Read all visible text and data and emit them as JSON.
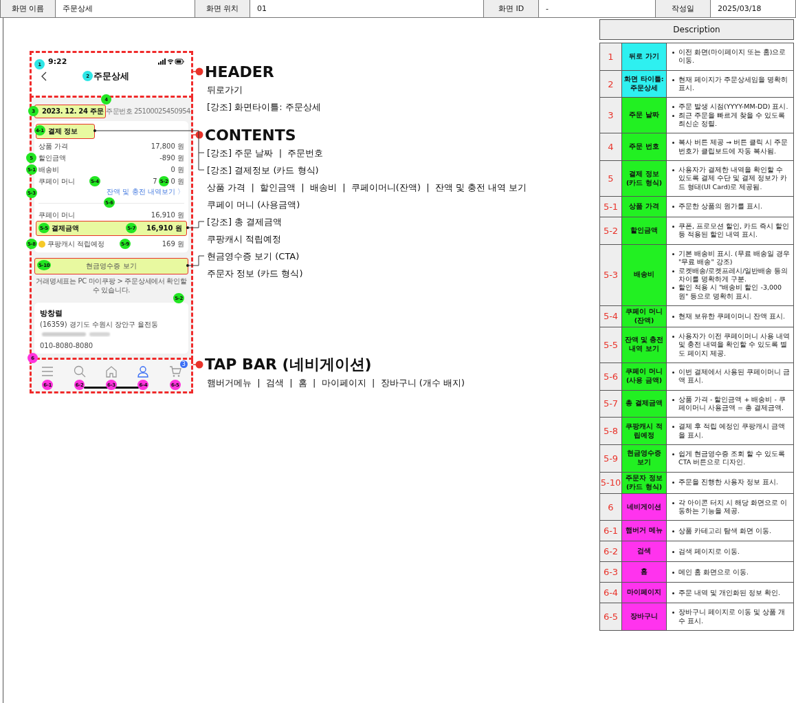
{
  "header_table": [
    {
      "label": "화면 이름",
      "value": "주문상세"
    },
    {
      "label": "화면 위치",
      "value": "01"
    },
    {
      "label": "화면 ID",
      "value": "-"
    },
    {
      "label": "작성일",
      "value": "2025/03/18"
    }
  ],
  "phone": {
    "time": "9:22",
    "title": "주문상세",
    "order_date": "2023. 12. 24 주문",
    "order_number": "주문번호 25100025450954",
    "payment_title": "결제 정보",
    "rows": [
      {
        "label": "상품 가격",
        "value": "17,800 원"
      },
      {
        "label": "할인금액",
        "value": "-890 원"
      },
      {
        "label": "배송비",
        "value": "0 원"
      }
    ],
    "coupay": {
      "label": "쿠페이 머니",
      "value_start": "7",
      "value_end": "0 원"
    },
    "balance_link": "잔액 및 충전 내역보기 〉",
    "used": {
      "label": "쿠페이 머니",
      "value": "16,910 원"
    },
    "total": {
      "label": "결제금액",
      "value": "16,910 원"
    },
    "cash": {
      "label": "쿠팡캐시 적립예정",
      "value": "169 원"
    },
    "receipt_button": "현금영수증 보기",
    "notice": "거래명세표는 PC 마이쿠팡 > 주문상세에서 확인할 수 있습니다.",
    "orderer": {
      "name": "방창렬",
      "address": "(16359) 경기도 수원시 장안구 율전동",
      "phone": "010-8080-8080"
    },
    "tabs": [
      {
        "kind": "menu",
        "selected": false
      },
      {
        "kind": "search",
        "selected": false
      },
      {
        "kind": "home",
        "selected": false
      },
      {
        "kind": "person",
        "selected": true
      },
      {
        "kind": "cart",
        "selected": false,
        "badge": "3"
      }
    ]
  },
  "markers": [
    {
      "label": "1",
      "color": "#2ee6e6"
    },
    {
      "label": "2",
      "color": "#2ee6e6"
    },
    {
      "label": "3",
      "color": "#22e622"
    },
    {
      "label": "4",
      "color": "#22e622"
    },
    {
      "label": "4-1",
      "color": "#22e622"
    },
    {
      "label": "5",
      "color": "#22e622"
    },
    {
      "label": "5-1",
      "color": "#22e622"
    },
    {
      "label": "5-4",
      "color": "#22e622"
    },
    {
      "label": "5-2",
      "color": "#22e622"
    },
    {
      "label": "5-3",
      "color": "#22e622"
    },
    {
      "label": "5-6",
      "color": "#22e622"
    },
    {
      "label": "5-5",
      "color": "#22e622"
    },
    {
      "label": "5-7",
      "color": "#22e622"
    },
    {
      "label": "5-8",
      "color": "#22e622"
    },
    {
      "label": "5-9",
      "color": "#22e622"
    },
    {
      "label": "5-10",
      "color": "#22e622"
    },
    {
      "label": "5-2",
      "color": "#22e622"
    },
    {
      "label": "6",
      "color": "#ff33dd"
    },
    {
      "label": "6-1",
      "color": "#ff33dd"
    },
    {
      "label": "6-2",
      "color": "#ff33dd"
    },
    {
      "label": "6-3",
      "color": "#ff33dd"
    },
    {
      "label": "6-4",
      "color": "#ff33dd"
    },
    {
      "label": "6-5",
      "color": "#ff33dd"
    }
  ],
  "annotations": [
    {
      "title": "HEADER",
      "lines": [
        "뒤로가기",
        "[강조] 화면타이틀: 주문상세"
      ]
    },
    {
      "title": "CONTENTS",
      "lines": [
        "[강조] 주문 날짜  |  주문번호",
        "[강조] 결제정보 (카드 형식)",
        "상품 가격  |  할인금액  |  배송비  |  쿠페이머니(잔액)  |  잔액 및 충전 내역 보기",
        "쿠페이 머니 (사용금액)",
        "[강조] 총 결제금액",
        "쿠팡캐시 적립예정",
        "현금영수증 보기 (CTA)",
        "주문자 정보 (카드 형식)"
      ]
    },
    {
      "title": "TAP BAR (네비게이션)",
      "lines": [
        "햄버거메뉴  |  검색  |  홈  |  마이페이지  |  장바구니 (개수 배지)"
      ]
    }
  ],
  "description": {
    "title": "Description",
    "rows": [
      {
        "num": "1",
        "name": "뒤로 가기",
        "color": "#2ef0f0",
        "bullets": [
          "이전 화면(마이페이지 또는 홈)으로 이동."
        ]
      },
      {
        "num": "2",
        "name": "화면 타이틀: 주문상세",
        "color": "#2ef0f0",
        "bullets": [
          "현재 페이지가 주문상세임을 명확히 표시."
        ]
      },
      {
        "num": "3",
        "name": "주문 날짜",
        "color": "#22f022",
        "bullets": [
          "주문 발생 시점(YYYY-MM-DD) 표시.",
          "최근 주문을 빠르게 찾을 수 있도록 최신순 정렬."
        ]
      },
      {
        "num": "4",
        "name": "주문 번호",
        "color": "#22f022",
        "bullets": [
          "복사 버튼 제공 → 버튼 클릭 시 주문번호가 클립보드에 자동 복사됨."
        ]
      },
      {
        "num": "5",
        "name": "결제 정보 (카드 형식)",
        "color": "#22f022",
        "bullets": [
          "사용자가 결제한 내역을 확인할 수 있도록 결제 수단 및 결제 정보가 카드 형태(UI Card)로 제공됨."
        ]
      },
      {
        "num": "5-1",
        "name": "상품 가격",
        "color": "#22f022",
        "bullets": [
          "주문한 상품의 원가를 표시."
        ]
      },
      {
        "num": "5-2",
        "name": "할인금액",
        "color": "#22f022",
        "bullets": [
          "쿠폰, 프로모션 할인, 카드 즉시 할인 등 적용된 할인 내역 표시."
        ]
      },
      {
        "num": "5-3",
        "name": "배송비",
        "color": "#22f022",
        "bullets": [
          "기본 배송비 표시. (무료 배송일 경우 \"무료 배송\" 강조)",
          "로켓배송/로켓프레시/일반배송 등의 차이를 명확하게 구분.",
          "할인 적용 시 \"배송비 할인 -3,000원\" 등으로 명확히 표시."
        ]
      },
      {
        "num": "5-4",
        "name": "쿠페이 머니 (잔액)",
        "color": "#22f022",
        "bullets": [
          "현재 보유한 쿠페이머니 잔액 표시."
        ]
      },
      {
        "num": "5-5",
        "name": "잔액 및 충전 내역 보기",
        "color": "#22f022",
        "bullets": [
          "사용자가 이전 쿠페이머니 사용 내역 및 충전 내역을 확인할 수 있도록 별도 페이지 제공."
        ]
      },
      {
        "num": "5-6",
        "name": "쿠페이 머니 (사용 금액)",
        "color": "#22f022",
        "bullets": [
          "이번 결제에서 사용된 쿠페이머니 금액 표시."
        ]
      },
      {
        "num": "5-7",
        "name": "총 결제금액",
        "color": "#22f022",
        "bullets": [
          "상품 가격 - 할인금액 + 배송비 - 쿠페이머니 사용금액 = 총 결제금액."
        ]
      },
      {
        "num": "5-8",
        "name": "쿠팡캐시 적립예정",
        "color": "#22f022",
        "bullets": [
          "결제 후 적립 예정인 쿠팡캐시 금액을 표시."
        ]
      },
      {
        "num": "5-9",
        "name": "현금영수증 보기",
        "color": "#22f022",
        "bullets": [
          "쉽게 현금영수증 조회 할 수 있도록 CTA 버튼으로 디자인."
        ]
      },
      {
        "num": "5-10",
        "name": "주문자 정보 (카드 형식)",
        "color": "#22f022",
        "bullets": [
          "주문을 진행한 사용자 정보 표시."
        ]
      },
      {
        "num": "6",
        "name": "네비게이션",
        "color": "#ff33ee",
        "bullets": [
          "각 아이콘 터치 시 해당 화면으로 이동하는 기능을 제공."
        ]
      },
      {
        "num": "6-1",
        "name": "햄버거 메뉴",
        "color": "#ff33ee",
        "bullets": [
          "상품 카테고리 탐색 화면 이동."
        ]
      },
      {
        "num": "6-2",
        "name": "검색",
        "color": "#ff33ee",
        "bullets": [
          "검색 페이지로 이동."
        ]
      },
      {
        "num": "6-3",
        "name": "홈",
        "color": "#ff33ee",
        "bullets": [
          "메인 홈 화면으로 이동."
        ]
      },
      {
        "num": "6-4",
        "name": "마이페이지",
        "color": "#ff33ee",
        "bullets": [
          "주문 내역 및 개인화된 정보 확인."
        ]
      },
      {
        "num": "6-5",
        "name": "장바구니",
        "color": "#ff33ee",
        "bullets": [
          "장바구니 페이지로 이동 및 상품 개수 표시."
        ]
      }
    ]
  }
}
